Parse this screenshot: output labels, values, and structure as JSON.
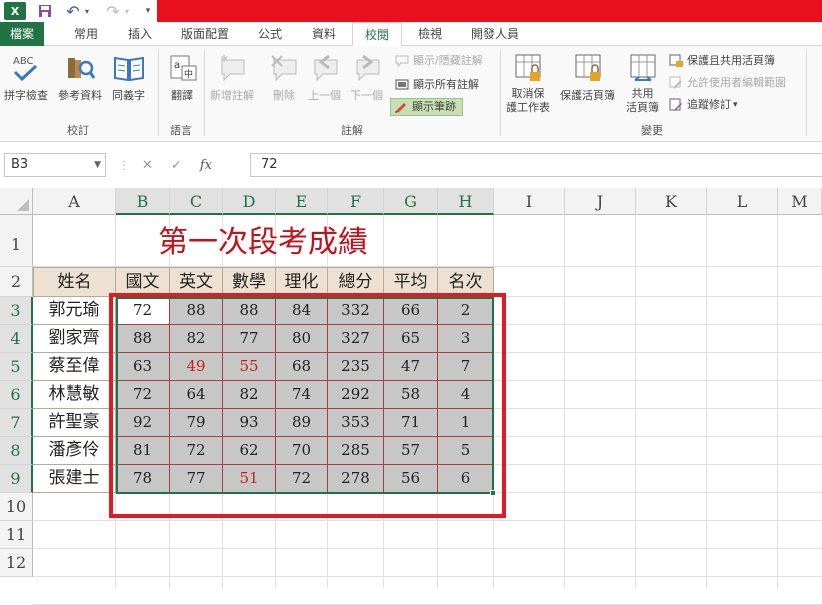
{
  "quick_access": {
    "app_icon": "excel-logo-icon",
    "save": "save-icon",
    "undo": "undo-icon",
    "redo": "redo-icon",
    "customize": "customize-qat-icon"
  },
  "tabs": [
    {
      "label": "檔案",
      "active": false,
      "file": true
    },
    {
      "label": "常用",
      "active": false
    },
    {
      "label": "插入",
      "active": false
    },
    {
      "label": "版面配置",
      "active": false
    },
    {
      "label": "公式",
      "active": false
    },
    {
      "label": "資料",
      "active": false
    },
    {
      "label": "校閱",
      "active": true
    },
    {
      "label": "檢視",
      "active": false
    },
    {
      "label": "開發人員",
      "active": false
    }
  ],
  "ribbon": {
    "spell_check": "拼字檢查",
    "research": "參考資料",
    "thesaurus": "同義字",
    "group_proofing": "校訂",
    "translate": "翻譯",
    "group_language": "語言",
    "new_comment": "新增註解",
    "delete": "刪除",
    "previous": "上一個",
    "next": "下一個",
    "show_hide_comment": "顯示/隱藏註解",
    "show_all_comments": "顯示所有註解",
    "show_ink": "顯示筆跡",
    "group_comments": "註解",
    "unprotect_sheet_1": "取消保",
    "unprotect_sheet_2": "護工作表",
    "protect_workbook": "保護活頁簿",
    "share_1": "共用",
    "share_2": "活頁簿",
    "protect_share": "保護且共用活頁簿",
    "allow_edit_ranges": "允許使用者編輯範圍",
    "track_changes": "追蹤修訂",
    "track_caret": "▾",
    "group_changes": "變更"
  },
  "formula_bar": {
    "name_box": "B3",
    "formula": "72",
    "fx": "fx",
    "cancel": "✕",
    "enter": "✓",
    "more": "⋮"
  },
  "columns": [
    "A",
    "B",
    "C",
    "D",
    "E",
    "F",
    "G",
    "H",
    "I",
    "J",
    "K",
    "L",
    "M"
  ],
  "rows": [
    "1",
    "2",
    "3",
    "4",
    "5",
    "6",
    "7",
    "8",
    "9",
    "10",
    "11",
    "12"
  ],
  "sheet": {
    "title": "第一次段考成績",
    "headers": [
      "姓名",
      "國文",
      "英文",
      "數學",
      "理化",
      "總分",
      "平均",
      "名次"
    ],
    "records": [
      {
        "name": "郭元瑜",
        "values": [
          "72",
          "88",
          "88",
          "84",
          "332",
          "66",
          "2"
        ]
      },
      {
        "name": "劉家齊",
        "values": [
          "88",
          "82",
          "77",
          "80",
          "327",
          "65",
          "3"
        ]
      },
      {
        "name": "蔡至偉",
        "values": [
          "63",
          "49",
          "55",
          "68",
          "235",
          "47",
          "7"
        ]
      },
      {
        "name": "林慧敏",
        "values": [
          "72",
          "64",
          "82",
          "74",
          "292",
          "58",
          "4"
        ]
      },
      {
        "name": "許聖豪",
        "values": [
          "92",
          "79",
          "93",
          "89",
          "353",
          "71",
          "1"
        ]
      },
      {
        "name": "潘彥伶",
        "values": [
          "81",
          "72",
          "62",
          "70",
          "285",
          "57",
          "5"
        ]
      },
      {
        "name": "張建士",
        "values": [
          "78",
          "77",
          "51",
          "72",
          "278",
          "56",
          "6"
        ]
      }
    ],
    "low_score_color": "#d01a1a"
  },
  "colors": {
    "excel_green": "#217346",
    "title_red": "#c1121c",
    "highlight_red": "#e01b26",
    "titlebar_red": "#e8101c"
  }
}
